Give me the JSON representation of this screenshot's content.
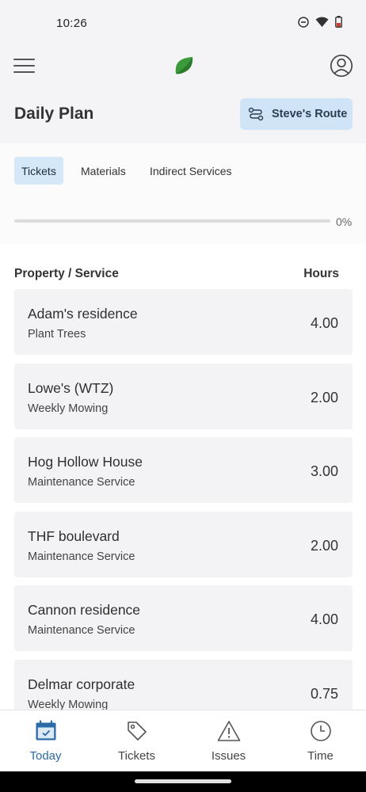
{
  "status_bar": {
    "time": "10:26"
  },
  "header": {
    "title": "Daily Plan",
    "route_button_label": "Steve's Route"
  },
  "tabs": [
    {
      "label": "Tickets",
      "active": true
    },
    {
      "label": "Materials",
      "active": false
    },
    {
      "label": "Indirect Services",
      "active": false
    }
  ],
  "progress": {
    "value": 0,
    "text": "0%"
  },
  "list": {
    "col_property": "Property / Service",
    "col_hours": "Hours",
    "rows": [
      {
        "property": "Adam's residence",
        "service": "Plant Trees",
        "hours": "4.00"
      },
      {
        "property": "Lowe's (WTZ)",
        "service": "Weekly Mowing",
        "hours": "2.00"
      },
      {
        "property": "Hog Hollow House",
        "service": "Maintenance Service",
        "hours": "3.00"
      },
      {
        "property": "THF boulevard",
        "service": "Maintenance Service",
        "hours": "2.00"
      },
      {
        "property": "Cannon residence",
        "service": "Maintenance Service",
        "hours": "4.00"
      },
      {
        "property": "Delmar corporate",
        "service": "Weekly Mowing",
        "hours": "0.75"
      }
    ]
  },
  "bottom_nav": [
    {
      "label": "Today",
      "icon": "calendar-icon",
      "active": true
    },
    {
      "label": "Tickets",
      "icon": "tag-icon",
      "active": false
    },
    {
      "label": "Issues",
      "icon": "warning-icon",
      "active": false
    },
    {
      "label": "Time",
      "icon": "clock-icon",
      "active": false
    }
  ],
  "colors": {
    "accent": "#2b6aa6",
    "active_tab_bg": "#d5e8f8",
    "route_button_bg": "#cfe5f7",
    "logo_green": "#3d9a3c"
  }
}
